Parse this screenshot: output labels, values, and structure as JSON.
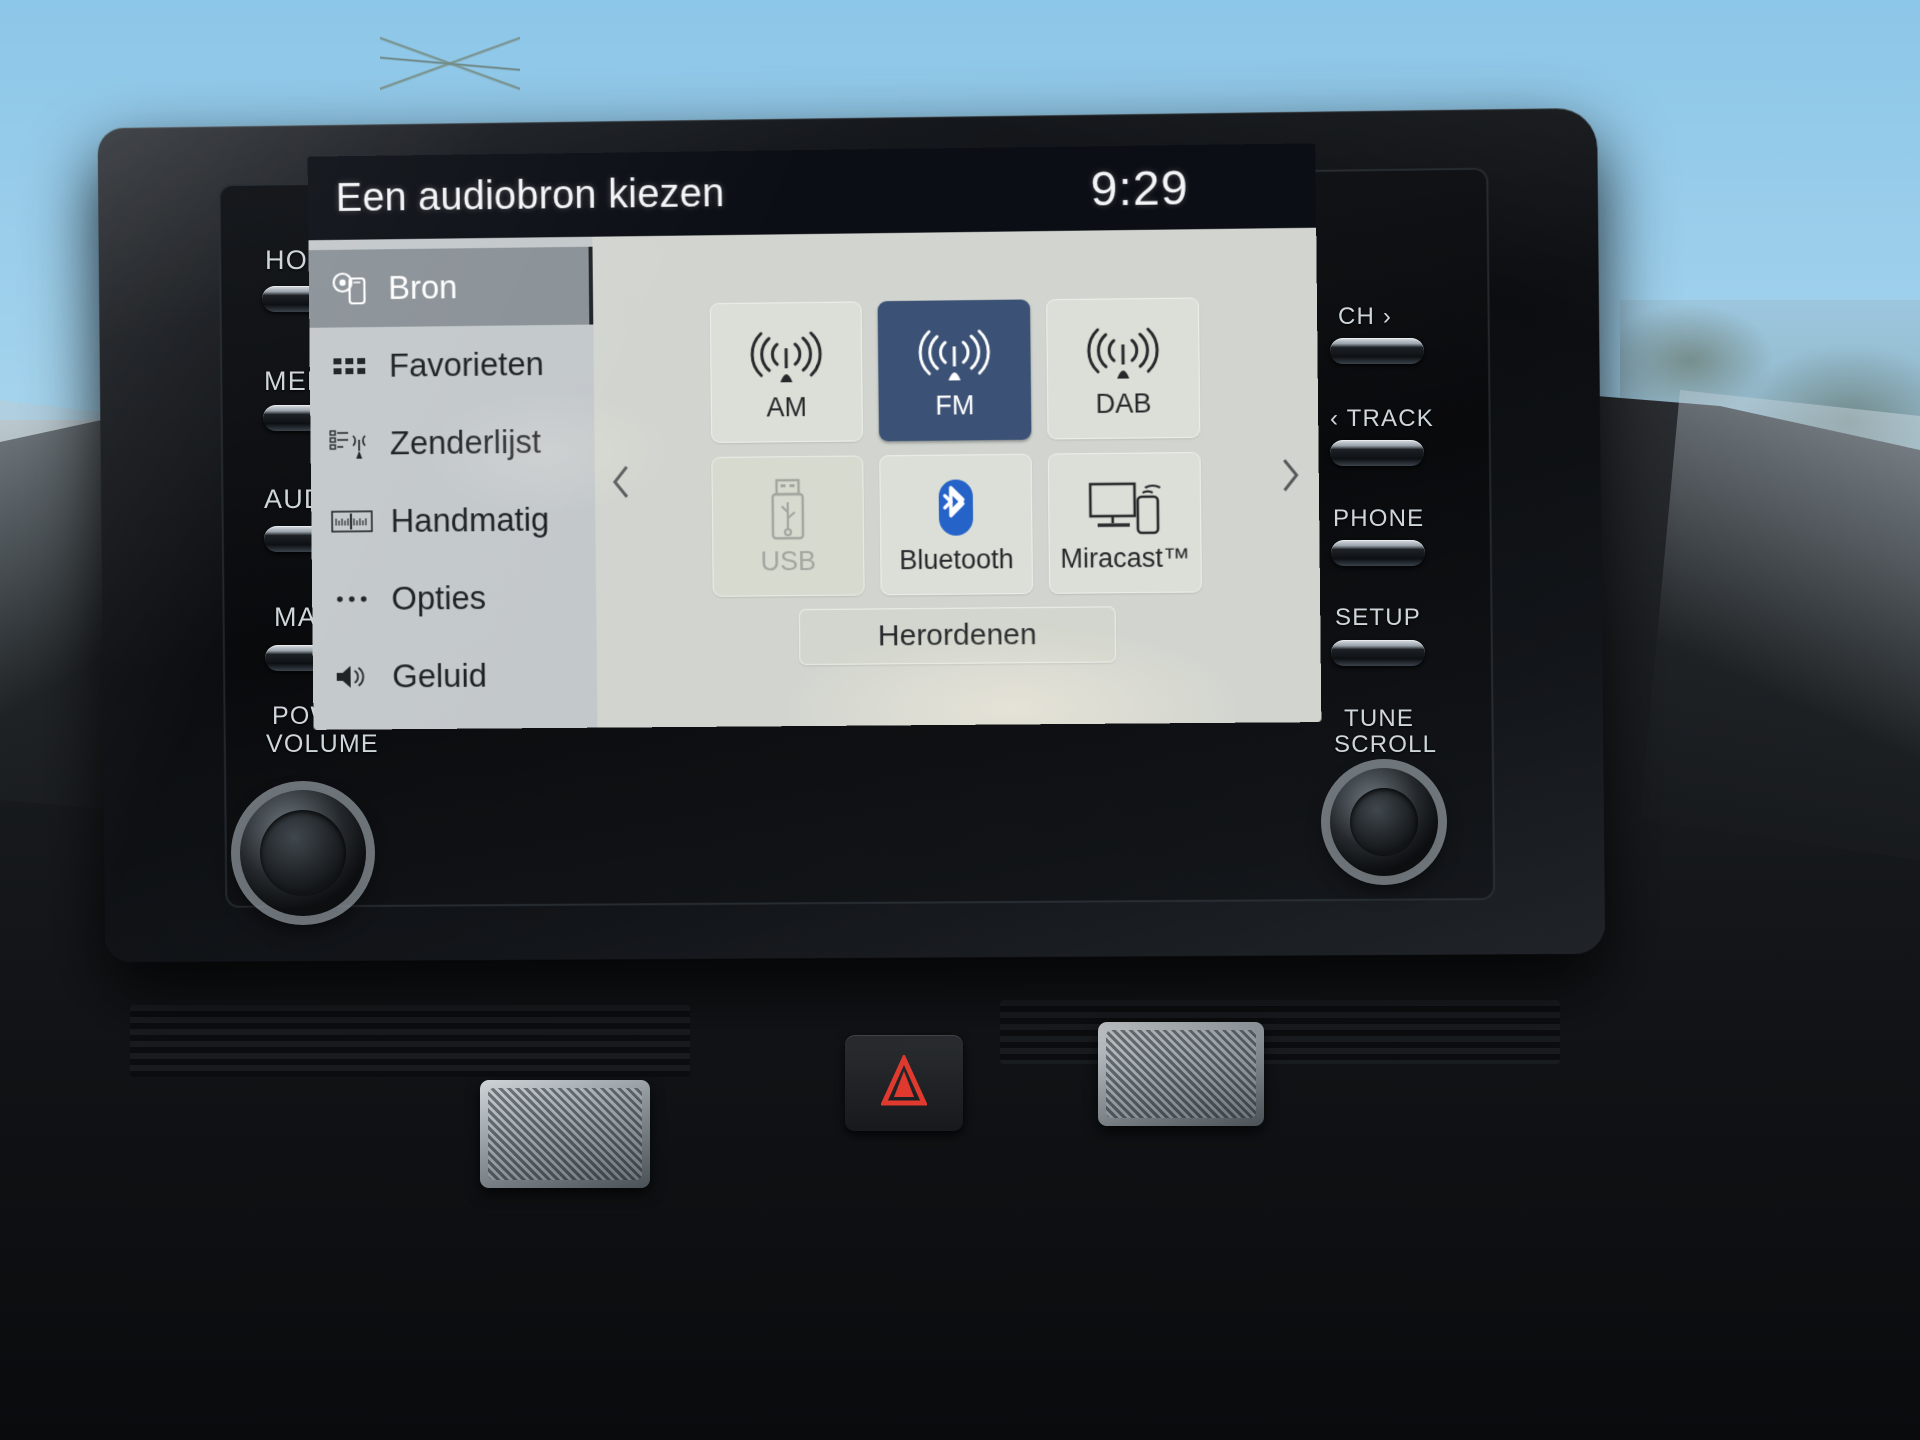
{
  "screen": {
    "title": "Een audiobron kiezen",
    "clock": "9:29",
    "sidebar": [
      {
        "label": "Bron",
        "icon": "source-icon",
        "active": true
      },
      {
        "label": "Favorieten",
        "icon": "favorites-icon",
        "active": false
      },
      {
        "label": "Zenderlijst",
        "icon": "station-list-icon",
        "active": false
      },
      {
        "label": "Handmatig",
        "icon": "manual-tune-icon",
        "active": false
      },
      {
        "label": "Opties",
        "icon": "options-icon",
        "active": false
      },
      {
        "label": "Geluid",
        "icon": "sound-icon",
        "active": false
      }
    ],
    "tiles": [
      {
        "label": "AM",
        "icon": "antenna-icon",
        "state": "normal"
      },
      {
        "label": "FM",
        "icon": "antenna-icon",
        "state": "selected"
      },
      {
        "label": "DAB",
        "icon": "antenna-icon",
        "state": "normal"
      },
      {
        "label": "USB",
        "icon": "usb-icon",
        "state": "disabled"
      },
      {
        "label": "Bluetooth",
        "icon": "bluetooth-icon",
        "state": "normal"
      },
      {
        "label": "Miracast™",
        "icon": "miracast-icon",
        "state": "normal"
      }
    ],
    "reorder_label": "Herordenen",
    "prev_arrow": "chevron-left-icon",
    "next_arrow": "chevron-right-icon",
    "colors": {
      "selected_tile": "#3b5276",
      "bluetooth_blue": "#2563c9",
      "sidebar_bg": "#c3c8cb",
      "sidebar_active": "#8a9197",
      "panel_bg": "#d2d5cf",
      "tile_bg": "#dcdfd7",
      "title_bar": "#0b0f15"
    }
  },
  "hard_buttons": {
    "left": [
      {
        "label": "HOME"
      },
      {
        "label": "MENU"
      },
      {
        "label": "AUDIO"
      },
      {
        "label": "MAP"
      }
    ],
    "left_knob": {
      "line1": "POWER",
      "line2": "VOLUME"
    },
    "right": [
      {
        "label": "CH ›"
      },
      {
        "label": "‹ TRACK"
      },
      {
        "label": "PHONE"
      },
      {
        "label": "SETUP"
      }
    ],
    "right_knob": {
      "line1": "TUNE",
      "line2": "SCROLL"
    }
  }
}
